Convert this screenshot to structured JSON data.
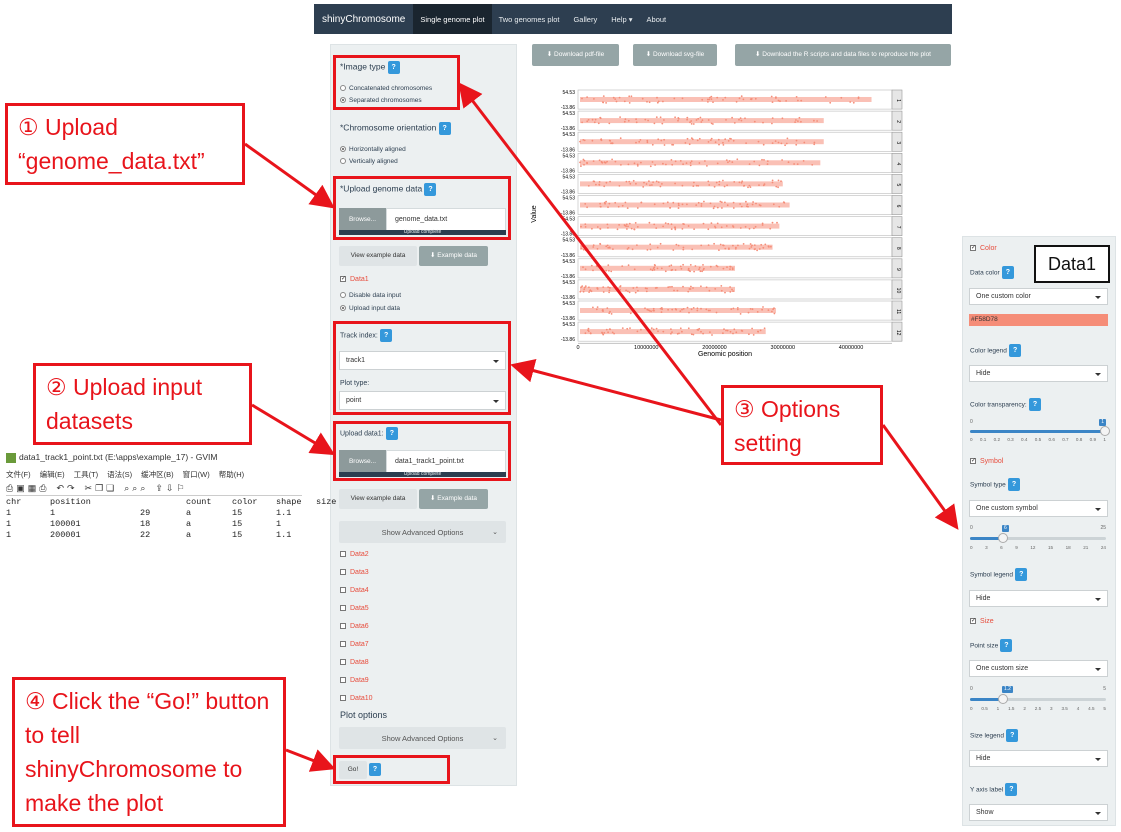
{
  "navbar": {
    "brand": "shinyChromosome",
    "items": [
      "Single genome plot",
      "Two genomes plot",
      "Gallery",
      "Help",
      "About"
    ],
    "help_caret": "▾"
  },
  "sidebar": {
    "image_type": {
      "label": "*Image type",
      "options": [
        "Concatenated chromosomes",
        "Separated chromosomes"
      ],
      "selected": 1
    },
    "orientation": {
      "label": "*Chromosome orientation",
      "options": [
        "Horizontally aligned",
        "Vertically aligned"
      ],
      "selected": 0
    },
    "upload_genome": {
      "label": "*Upload genome data",
      "browse": "Browse...",
      "file": "genome_data.txt",
      "progress": "Upload complete"
    },
    "view_example": "View example data",
    "example_data": "Example data",
    "data1": {
      "label": "Data1",
      "options": [
        "Disable data input",
        "Upload input data"
      ],
      "selected": 1
    },
    "track_index": {
      "label": "Track index:",
      "value": "track1"
    },
    "plot_type": {
      "label": "Plot type:",
      "value": "point"
    },
    "upload_data1": {
      "label": "Upload data1:",
      "browse": "Browse...",
      "file": "data1_track1_point.txt",
      "progress": "Upload complete"
    },
    "view_example2": "View example data",
    "example_data2": "Example data",
    "advanced": "Show Advanced Options",
    "data_list": [
      "Data2",
      "Data3",
      "Data4",
      "Data5",
      "Data6",
      "Data7",
      "Data8",
      "Data9",
      "Data10"
    ],
    "plot_options": "Plot options",
    "advanced2": "Show Advanced Options",
    "go": "Go!",
    "help_q": "?"
  },
  "downloads": {
    "pdf": "Download pdf-file",
    "svg": "Download svg-file",
    "scripts": "Download the R scripts and data files to reproduce the plot"
  },
  "plot": {
    "ylabel": "Value",
    "xlabel": "Genomic position",
    "ymax": "54.53",
    "ymin": "-13.86",
    "xticks": [
      "0",
      "10000000",
      "20000000",
      "30000000",
      "40000000"
    ],
    "chromosomes": [
      "1",
      "2",
      "3",
      "4",
      "5",
      "6",
      "7",
      "8",
      "9",
      "10",
      "11",
      "12"
    ],
    "point_color": "#F58D78"
  },
  "right_panel": {
    "color": {
      "label": "Color",
      "data_color": "Data color",
      "data_color_value": "One custom color",
      "hex": "#F58D78"
    },
    "color_legend": {
      "label": "Color legend",
      "value": "Hide"
    },
    "transparency": {
      "label": "Color transparency:",
      "min": "0",
      "max": "1",
      "current": "1",
      "ticks": [
        "0",
        "0.1",
        "0.2",
        "0.3",
        "0.4",
        "0.5",
        "0.6",
        "0.7",
        "0.8",
        "0.9",
        "1"
      ]
    },
    "symbol": {
      "label": "Symbol",
      "type_label": "Symbol type",
      "type_value": "One custom symbol",
      "min": "0",
      "max": "25",
      "current": "6",
      "ticks": [
        "0",
        "3",
        "6",
        "9",
        "12",
        "15",
        "18",
        "21",
        "24"
      ]
    },
    "symbol_legend": {
      "label": "Symbol legend",
      "value": "Hide"
    },
    "size": {
      "label": "Size",
      "point_label": "Point size",
      "point_value": "One custom size",
      "min": "0",
      "max": "5",
      "current": "1.2",
      "ticks": [
        "0",
        "0.5",
        "1",
        "1.5",
        "2",
        "2.5",
        "3",
        "3.5",
        "4",
        "4.5",
        "5"
      ]
    },
    "size_legend": {
      "label": "Size legend",
      "value": "Hide"
    },
    "y_axis": {
      "label": "Y axis label",
      "value": "Show"
    }
  },
  "data1_tag": "Data1",
  "callouts": {
    "c1": "① Upload “genome_data.txt”",
    "c2": "② Upload input datasets",
    "c3": "③ Options setting",
    "c4": "④ Click the “Go!” button to tell shinyChromosome to make the plot"
  },
  "gvim": {
    "title": "data1_track1_point.txt (E:\\apps\\example_17) - GVIM",
    "menu": [
      "文件(F)",
      "编辑(E)",
      "工具(T)",
      "语法(S)",
      "缓冲区(B)",
      "窗口(W)",
      "帮助(H)"
    ],
    "header": [
      "chr",
      "position",
      "count",
      "color",
      "shape",
      "size"
    ],
    "rows": [
      [
        "1",
        "1",
        "29",
        "a",
        "15",
        "1.1"
      ],
      [
        "1",
        "100001",
        "18",
        "a",
        "15",
        "1"
      ],
      [
        "1",
        "200001",
        "22",
        "a",
        "15",
        "1.1"
      ]
    ]
  },
  "colors": {
    "accent": "#3498db",
    "navbar": "#2d3e50",
    "red": "#e8141b",
    "link_red": "#e74c3c"
  }
}
